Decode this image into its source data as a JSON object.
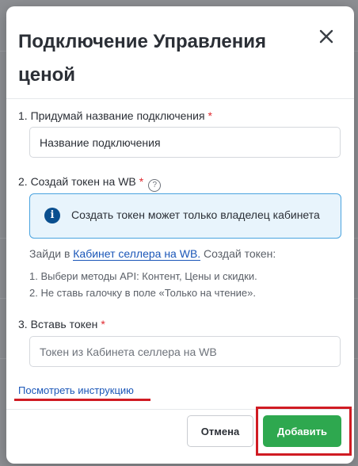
{
  "modal": {
    "title": "Подключение Управления ценой",
    "close_icon": "close-icon"
  },
  "fields": {
    "name": {
      "label": "1. Придумай название подключения",
      "required_mark": "*",
      "placeholder": "Название подключения"
    },
    "token_create": {
      "label": "2. Создай токен на WB",
      "required_mark": "*",
      "help_icon": "?"
    },
    "token": {
      "label": "3. Вставь токен",
      "required_mark": "*",
      "placeholder": "Токен из Кабинета селлера на WB"
    }
  },
  "info": {
    "icon": "i",
    "text": "Создать токен может только владелец кабинета"
  },
  "instructions": {
    "prefix": "Зайди в ",
    "link": "Кабинет селлера на WB.",
    "suffix": " Создай токен:",
    "step1": "1. Выбери методы API: Контент, Цены и скидки.",
    "step2": "2. Не ставь галочку в поле «Только на чтение»."
  },
  "footer": {
    "instruction_link": "Посмотреть инструкцию",
    "cancel_label": "Отмена",
    "add_label": "Добавить"
  },
  "colors": {
    "primary_green": "#2ea84f",
    "link_blue": "#1a56b8",
    "info_bg": "#e8f4fc",
    "info_border": "#4aa3df",
    "required_red": "#e0282e",
    "highlight_red": "#d01b23"
  }
}
